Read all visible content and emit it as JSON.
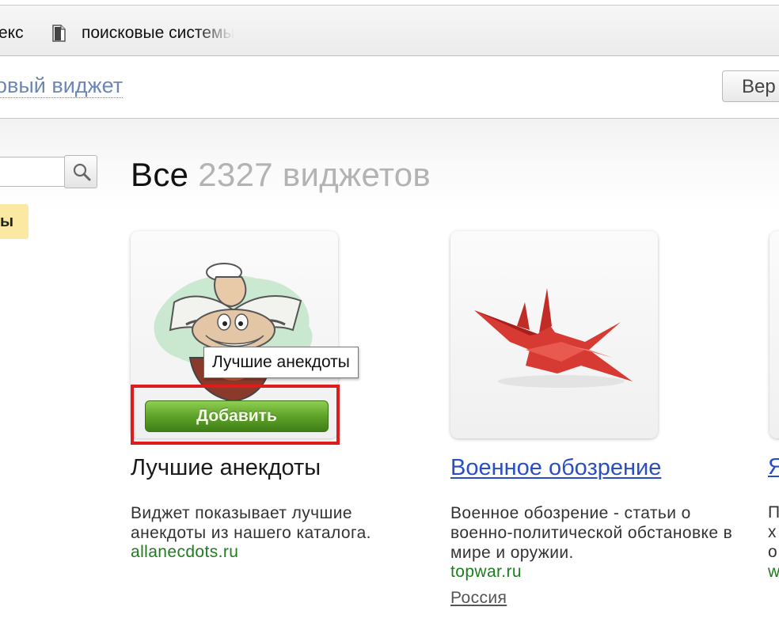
{
  "bookmarks": {
    "item1_label": "екс",
    "item2_label": "поисковые системы"
  },
  "header": {
    "add_widget_link": "овый виджет",
    "return_button_label": "Вер"
  },
  "sidebar": {
    "search_placeholder": "",
    "active_category_label": "ы"
  },
  "main": {
    "heading_all": "Все",
    "heading_count": "2327 виджетов"
  },
  "widgets": [
    {
      "title": "Лучшие анекдоты",
      "description": "Виджет показывает лучшие анекдоты из нашего каталога.",
      "site": "allanecdots.ru",
      "tooltip": "Лучшие анекдоты",
      "add_button_label": "Добавить"
    },
    {
      "title": "Военное обозрение",
      "description": "Военное обозрение - статьи о военно-политической обстановке в мире и оружии.",
      "site": "topwar.ru",
      "region": "Россия"
    }
  ],
  "partial_widget": {
    "title_fragment": "Я",
    "line1": "П",
    "line2": "х",
    "line3": "о",
    "line4": "w"
  },
  "colors": {
    "link_blue": "#2a4fc4",
    "site_green": "#1e7d1e",
    "highlight_red": "#e01b1b",
    "button_green": "#5ea329",
    "category_yellow": "#fbe9a3"
  },
  "icons": {
    "search": "search-icon",
    "document": "document-icon"
  }
}
